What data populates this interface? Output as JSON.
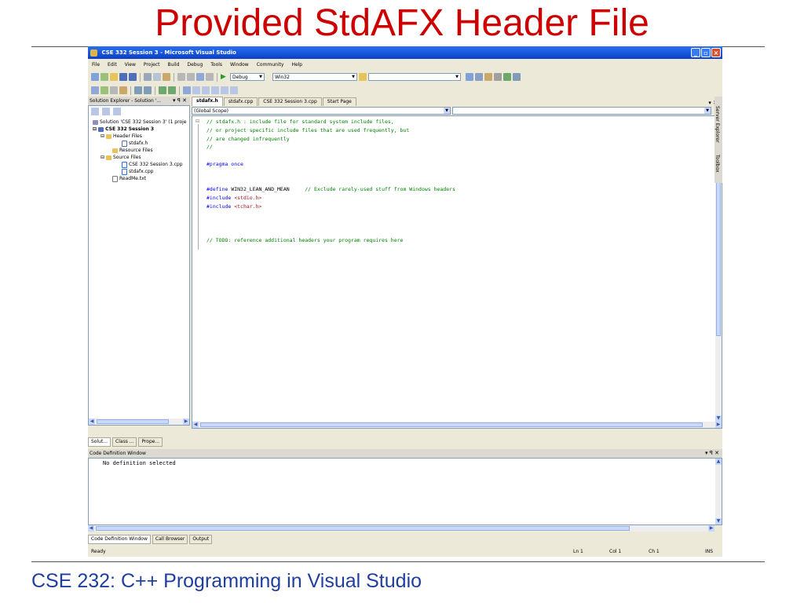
{
  "slide": {
    "title": "Provided StdAFX Header File",
    "footer": "CSE 232: C++ Programming in Visual Studio"
  },
  "window": {
    "title": "CSE 332 Session 3 - Microsoft Visual Studio",
    "buttons": [
      "_",
      "▫",
      "×"
    ]
  },
  "menu": [
    "File",
    "Edit",
    "View",
    "Project",
    "Build",
    "Debug",
    "Tools",
    "Window",
    "Community",
    "Help"
  ],
  "toolbar": {
    "config": "Debug",
    "platform": "Win32"
  },
  "solution_explorer": {
    "header": "Solution Explorer - Solution '...",
    "controls": "▾ ꟼ ✕",
    "tree": [
      {
        "label": "Solution 'CSE 332 Session 3' (1 proje",
        "depth": 0
      },
      {
        "label": "CSE 332 Session 3",
        "depth": 1
      },
      {
        "label": "Header Files",
        "depth": 2
      },
      {
        "label": "stdafx.h",
        "depth": 3
      },
      {
        "label": "Resource Files",
        "depth": 2
      },
      {
        "label": "Source Files",
        "depth": 2
      },
      {
        "label": "CSE 332 Session 3.cpp",
        "depth": 3
      },
      {
        "label": "stdafx.cpp",
        "depth": 3
      },
      {
        "label": "ReadMe.txt",
        "depth": 2
      }
    ],
    "tabs": [
      "Solut...",
      "Class ...",
      "Prope..."
    ]
  },
  "editor": {
    "tabs": [
      "stdafx.h",
      "stdafx.cpp",
      "CSE 332 Session 3.cpp",
      "Start Page"
    ],
    "active_tab": "stdafx.h",
    "tab_controls": "▾ ✕",
    "scope": "(Global Scope)",
    "code": [
      {
        "type": "comment",
        "text": "// stdafx.h : include file for standard system include files,"
      },
      {
        "type": "comment",
        "text": "// or project specific include files that are used frequently, but"
      },
      {
        "type": "comment",
        "text": "// are changed infrequently"
      },
      {
        "type": "comment",
        "text": "//"
      },
      {
        "type": "blank",
        "text": ""
      },
      {
        "type": "kw",
        "text": "#pragma once"
      },
      {
        "type": "blank",
        "text": ""
      },
      {
        "type": "blank",
        "text": ""
      },
      {
        "type": "define",
        "kw": "#define",
        "name": " WIN32_LEAN_AND_MEAN",
        "comment": "     // Exclude rarely-used stuff from Windows headers"
      },
      {
        "type": "include",
        "kw": "#include",
        "str": " <stdio.h>"
      },
      {
        "type": "include",
        "kw": "#include",
        "str": " <tchar.h>"
      },
      {
        "type": "blank",
        "text": ""
      },
      {
        "type": "blank",
        "text": ""
      },
      {
        "type": "blank",
        "text": ""
      },
      {
        "type": "comment",
        "text": "// TODO: reference additional headers your program requires here"
      }
    ]
  },
  "side_tabs": [
    "Server Explorer",
    "Toolbox"
  ],
  "code_definition": {
    "header": "Code Definition Window",
    "controls": "▾ ꟼ ✕",
    "content": "No definition selected",
    "tabs": [
      "Code Definition Window",
      "Call Browser",
      "Output"
    ]
  },
  "status": {
    "left": "Ready",
    "ln": "Ln 1",
    "col": "Col 1",
    "ch": "Ch 1",
    "mode": "INS"
  }
}
